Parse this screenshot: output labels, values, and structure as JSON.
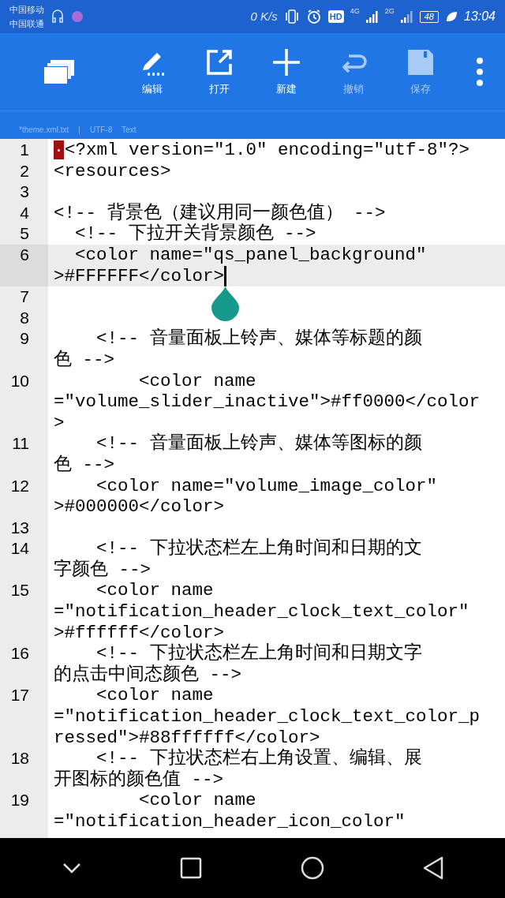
{
  "status_bar": {
    "carriers": [
      "中国移动",
      "中国联通"
    ],
    "speed": "0 K/s",
    "hd": "HD",
    "network_1": "4G",
    "network_2": "2G",
    "battery": "48",
    "time": "13:04"
  },
  "toolbar": {
    "actions": [
      {
        "kind": "edit",
        "label": "编辑",
        "disabled": false
      },
      {
        "kind": "open",
        "label": "打开",
        "disabled": false
      },
      {
        "kind": "new",
        "label": "新建",
        "disabled": false
      },
      {
        "kind": "undo",
        "label": "撤销",
        "disabled": true
      },
      {
        "kind": "save",
        "label": "保存",
        "disabled": true
      }
    ]
  },
  "file_info": {
    "file_name": "*theme.xml.txt",
    "separator": "|",
    "encoding": "UTF-8",
    "type": "Text"
  },
  "editor": {
    "lines": [
      {
        "number": "1",
        "current": false,
        "rows": [
          "<?xml version=\"1.0\" encoding=\"utf-8\"?>"
        ]
      },
      {
        "number": "2",
        "current": false,
        "rows": [
          "<resources>"
        ]
      },
      {
        "number": "3",
        "current": false
      },
      {
        "number": "4",
        "current": false,
        "rows": [
          "<!-- 背景色（建议用同一颜色值） -->"
        ]
      },
      {
        "number": "5",
        "current": false,
        "rows": [
          "  <!-- 下拉开关背景颜色 -->"
        ]
      },
      {
        "number": "6",
        "current": true,
        "rows": [
          "  <color name=\"qs_panel_background\"",
          ">#FFFFFF</color>"
        ]
      },
      {
        "number": "7",
        "current": false
      },
      {
        "number": "8",
        "current": false
      },
      {
        "number": "9",
        "current": false,
        "rows": [
          "    <!-- 音量面板上铃声、媒体等标题的颜",
          "色 -->"
        ]
      },
      {
        "number": "10",
        "current": false,
        "rows": [
          "        <color name",
          "=\"volume_slider_inactive\">#ff0000</color",
          ">"
        ]
      },
      {
        "number": "11",
        "current": false,
        "rows": [
          "    <!-- 音量面板上铃声、媒体等图标的颜",
          "色 -->"
        ]
      },
      {
        "number": "12",
        "current": false,
        "rows": [
          "    <color name=\"volume_image_color\"",
          ">#000000</color>"
        ]
      },
      {
        "number": "13",
        "current": false
      },
      {
        "number": "14",
        "current": false,
        "rows": [
          "    <!-- 下拉状态栏左上角时间和日期的文",
          "字颜色 -->"
        ]
      },
      {
        "number": "15",
        "current": false,
        "rows": [
          "    <color name",
          "=\"notification_header_clock_text_color\"",
          ">#ffffff</color>"
        ]
      },
      {
        "number": "16",
        "current": false,
        "rows": [
          "    <!-- 下拉状态栏左上角时间和日期文字",
          "的点击中间态颜色 -->"
        ]
      },
      {
        "number": "17",
        "current": false,
        "rows": [
          "    <color name",
          "=\"notification_header_clock_text_color_p",
          "ressed\">#88ffffff</color>"
        ]
      },
      {
        "number": "18",
        "current": false,
        "rows": [
          "    <!-- 下拉状态栏右上角设置、编辑、展",
          "开图标的颜色值 -->"
        ]
      },
      {
        "number": "19",
        "current": false,
        "rows": [
          "        <color name",
          "=\"notification_header_icon_color\""
        ]
      }
    ]
  }
}
